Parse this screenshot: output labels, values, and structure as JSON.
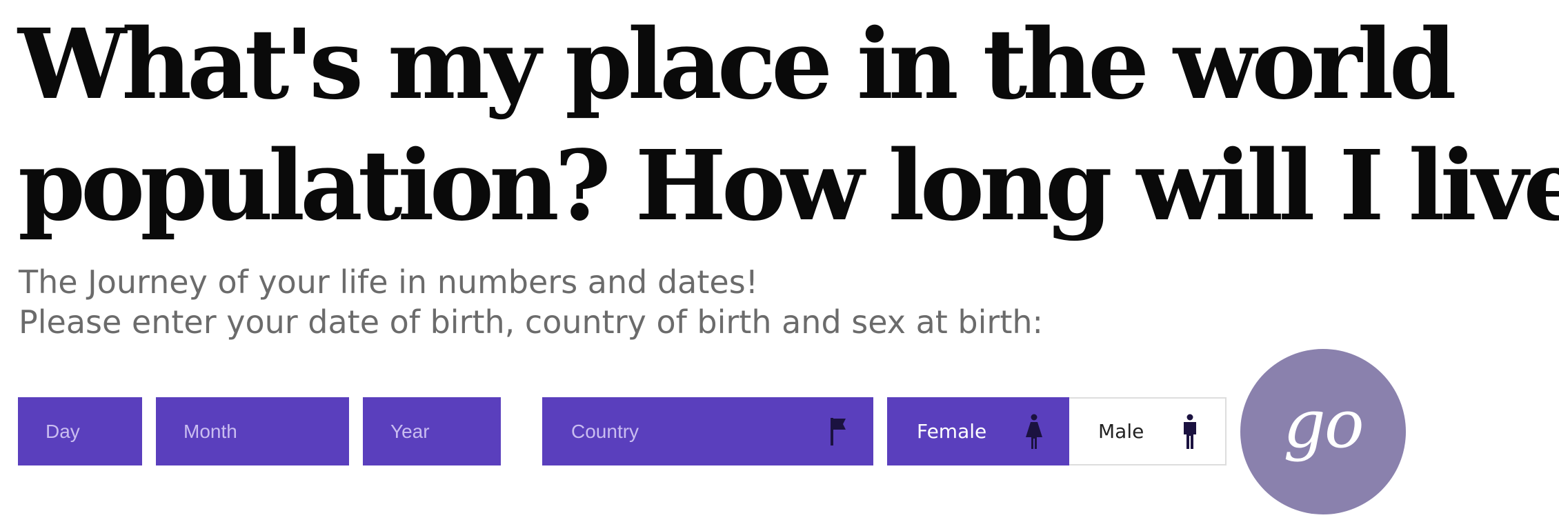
{
  "header": {
    "title_line1": "What's my place in the world",
    "title_line2": "population? How long will I live?",
    "subtitle_line1": "The Journey of your life in numbers and dates!",
    "subtitle_line2": "Please enter your date of birth, country of birth and sex at birth:"
  },
  "form": {
    "day": {
      "placeholder": "Day"
    },
    "month": {
      "placeholder": "Month"
    },
    "year": {
      "placeholder": "Year"
    },
    "country": {
      "placeholder": "Country",
      "icon": "flag-icon"
    },
    "sex": {
      "female_label": "Female",
      "male_label": "Male",
      "selected": "Female",
      "female_icon": "female-person-icon",
      "male_icon": "male-person-icon"
    },
    "go_label": "go"
  },
  "colors": {
    "accent": "#5a3fbd",
    "go_button": "#8a81ad",
    "icon_dark": "#1b1240",
    "subtitle": "#6b6b6b"
  }
}
